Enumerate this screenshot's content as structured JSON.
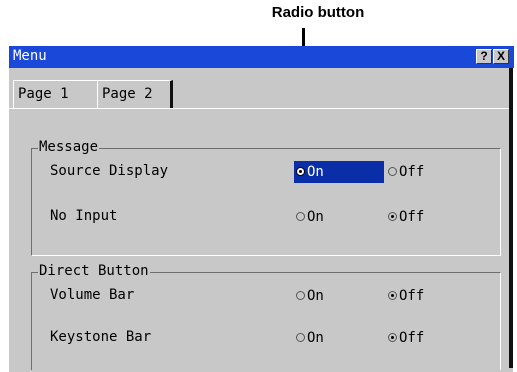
{
  "callout": {
    "label": "Radio button"
  },
  "window": {
    "title": "Menu",
    "help_label": "?",
    "close_label": "X"
  },
  "tabs": [
    {
      "label": "Page 1",
      "active": false
    },
    {
      "label": "Page 2",
      "active": true
    }
  ],
  "groups": [
    {
      "label": "Message",
      "rows": [
        {
          "label": "Source Display",
          "options": [
            {
              "label": "On",
              "checked": true,
              "highlighted": true
            },
            {
              "label": "Off",
              "checked": false
            }
          ]
        },
        {
          "label": "No Input",
          "options": [
            {
              "label": "On",
              "checked": false
            },
            {
              "label": "Off",
              "checked": true
            }
          ]
        }
      ]
    },
    {
      "label": "Direct Button",
      "rows": [
        {
          "label": "Volume Bar",
          "options": [
            {
              "label": "On",
              "checked": false
            },
            {
              "label": "Off",
              "checked": true
            }
          ]
        },
        {
          "label": "Keystone Bar",
          "options": [
            {
              "label": "On",
              "checked": false
            },
            {
              "label": "Off",
              "checked": true
            }
          ]
        }
      ]
    }
  ],
  "colors": {
    "titlebar": "#1a48d8",
    "selection": "#0a2ea8",
    "face": "#c8c8c8"
  }
}
